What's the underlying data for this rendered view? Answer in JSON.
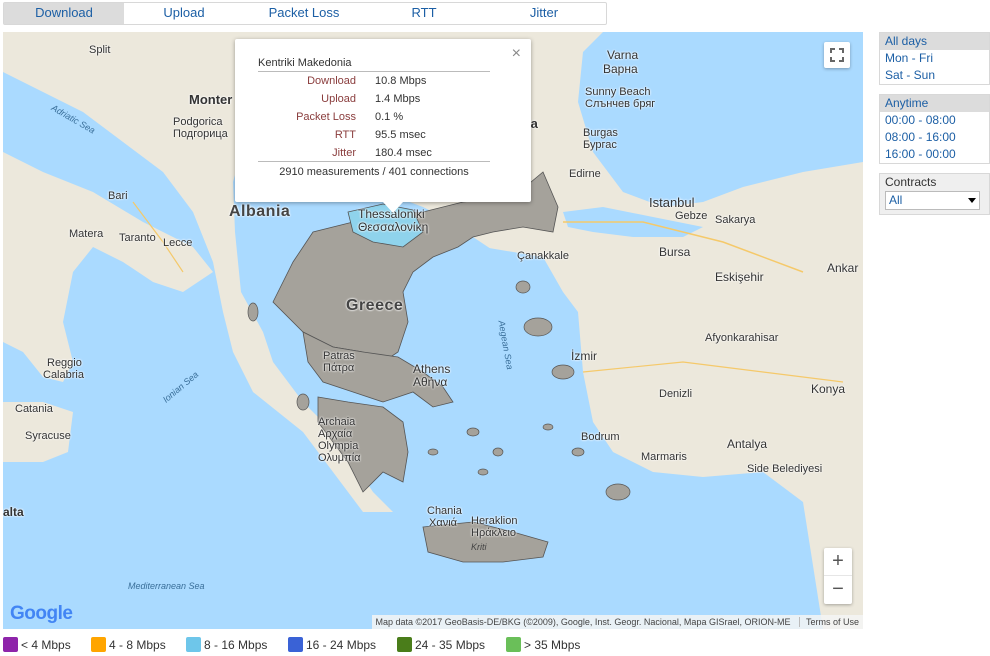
{
  "tabs": [
    "Download",
    "Upload",
    "Packet Loss",
    "RTT",
    "Jitter"
  ],
  "popup": {
    "region": "Kentriki Makedonia",
    "close": "×",
    "rows": [
      {
        "label": "Download",
        "value": "10.8 Mbps"
      },
      {
        "label": "Upload",
        "value": "1.4 Mbps"
      },
      {
        "label": "Packet Loss",
        "value": "0.1 %"
      },
      {
        "label": "RTT",
        "value": "95.5 msec"
      },
      {
        "label": "Jitter",
        "value": "180.4 msec"
      }
    ],
    "summary": "2910 measurements / 401 connections"
  },
  "map": {
    "labels": {
      "split": "Split",
      "montenegro": "Monter",
      "podgorica": "Podgorica",
      "podgorica_cyr": "Подгорица",
      "adriatic": "Adriatic Sea",
      "bari": "Bari",
      "matera": "Matera",
      "taranto": "Taranto",
      "lecce": "Lecce",
      "albania": "Albania",
      "greece": "Greece",
      "thessaloniki": "Thessaloniki",
      "thessaloniki_gr": "Θεσσαλονίκη",
      "varna": "Varna",
      "varna_cyr": "Варна",
      "sunny_beach": "Sunny Beach",
      "sunny_beach_cyr": "Слънчев бряг",
      "burgas": "Burgas",
      "burgas_cyr": "Бургас",
      "edirne": "Edirne",
      "istanbul": "Istanbul",
      "gebze": "Gebze",
      "sakarya": "Sakarya",
      "bursa": "Bursa",
      "canakkale": "Çanakkale",
      "eskisehir": "Eskişehir",
      "ankara": "Ankar",
      "aegean": "Aegean Sea",
      "izmir": "İzmir",
      "afyon": "Afyonkarahisar",
      "denizli": "Denizli",
      "konya": "Konya",
      "ionian": "Ionian Sea",
      "patras": "Patras",
      "patras_gr": "Πάτρα",
      "athens": "Athens",
      "athens_gr": "Αθήνα",
      "arhaia": "Archaia",
      "arhaia_gr": "Αρχαία",
      "olympia": "Olympia",
      "olympia_gr": "Ολυμπία",
      "reggio": "Reggio",
      "calabria": "Calabria",
      "catania": "Catania",
      "syracuse": "Syracuse",
      "malta": "alta",
      "bodrum": "Bodrum",
      "marmaris": "Marmaris",
      "antalya": "Antalya",
      "side": "Side Belediyesi",
      "chania": "Chania",
      "chania_gr": "Χανιά",
      "heraklion": "Heraklion",
      "heraklion_gr": "Ηράκλειο",
      "kriti": "Kriti",
      "mediterranean": "Mediterranean Sea",
      "ia": "ia"
    },
    "attribution": "Map data ©2017 GeoBasis-DE/BKG (©2009), Google, Inst. Geogr. Nacional, Mapa GISrael, ORION-ME",
    "terms": "Terms of Use",
    "logo": "Google",
    "zoom_in": "+",
    "zoom_out": "−",
    "fullscreen_icon": "fullscreen-icon"
  },
  "days": [
    "All days",
    "Mon - Fri",
    "Sat - Sun"
  ],
  "times": [
    "Anytime",
    "00:00 - 08:00",
    "08:00 - 16:00",
    "16:00 - 00:00"
  ],
  "contracts": {
    "label": "Contracts",
    "selected": "All"
  },
  "legend": [
    {
      "label": "< 4 Mbps",
      "color": "#8e24aa"
    },
    {
      "label": "4 - 8 Mbps",
      "color": "#ffa500"
    },
    {
      "label": "8 - 16 Mbps",
      "color": "#6ec6ea"
    },
    {
      "label": "16 - 24 Mbps",
      "color": "#3a62d6"
    },
    {
      "label": "24 - 35 Mbps",
      "color": "#4a7d1a"
    },
    {
      "label": "> 35 Mbps",
      "color": "#6abf59"
    }
  ]
}
